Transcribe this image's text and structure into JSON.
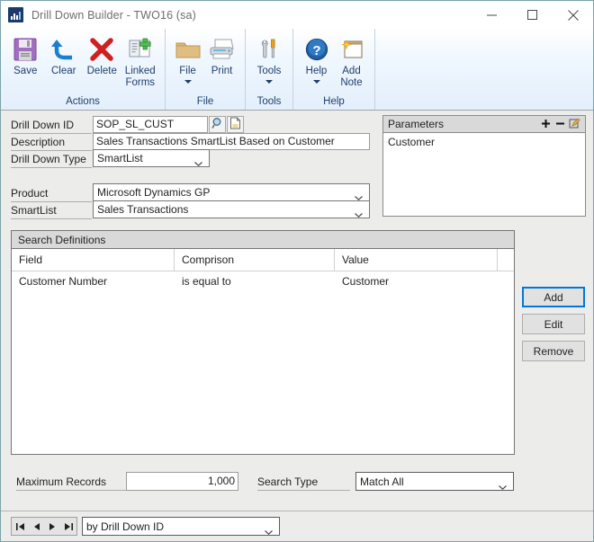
{
  "window": {
    "title": "Drill Down Builder  -  TWO16 (sa)",
    "app_icon": "bar-chart-icon",
    "minimize": "minimize-icon",
    "maximize": "maximize-icon",
    "close": "close-icon"
  },
  "ribbon": {
    "groups": [
      {
        "label": "Actions",
        "items": [
          {
            "label": "Save",
            "icon": "save-floppy-icon",
            "has_caret": false
          },
          {
            "label": "Clear",
            "icon": "undo-arrow-icon",
            "has_caret": false
          },
          {
            "label": "Delete",
            "icon": "red-x-icon",
            "has_caret": false
          },
          {
            "label": "Linked\nForms",
            "label_line1": "Linked",
            "label_line2": "Forms",
            "icon": "linked-forms-icon",
            "has_caret": false
          }
        ]
      },
      {
        "label": "File",
        "items": [
          {
            "label": "File",
            "icon": "folder-icon",
            "has_caret": true
          },
          {
            "label": "Print",
            "icon": "printer-icon",
            "has_caret": false
          }
        ]
      },
      {
        "label": "Tools",
        "items": [
          {
            "label": "Tools",
            "icon": "wrench-screwdriver-icon",
            "has_caret": true
          }
        ]
      },
      {
        "label": "Help",
        "items": [
          {
            "label": "Help",
            "icon": "help-question-icon",
            "has_caret": true
          },
          {
            "label": "Add\nNote",
            "label_line1": "Add",
            "label_line2": "Note",
            "icon": "add-note-icon",
            "has_caret": false
          }
        ]
      }
    ]
  },
  "form": {
    "drill_down_id": {
      "label": "Drill Down ID",
      "value": "SOP_SL_CUST"
    },
    "description": {
      "label": "Description",
      "value": "Sales Transactions SmartList Based on Customer"
    },
    "drill_down_type": {
      "label": "Drill Down Type",
      "value": "SmartList"
    },
    "product": {
      "label": "Product",
      "value": "Microsoft Dynamics GP"
    },
    "smartlist": {
      "label": "SmartList",
      "value": "Sales Transactions"
    },
    "lookup_icon": "magnifier-lookup-icon",
    "note_icon": "note-page-icon"
  },
  "parameters": {
    "title": "Parameters",
    "add_icon": "plus-icon",
    "remove_icon": "minus-icon",
    "edit_icon": "pencil-edit-icon",
    "items": [
      "Customer"
    ]
  },
  "search_definitions": {
    "title": "Search Definitions",
    "columns": [
      "Field",
      "Comprison",
      "Value",
      ""
    ],
    "rows": [
      {
        "field": "Customer Number",
        "comparison": "is equal to",
        "value": "Customer",
        "extra": ""
      }
    ],
    "buttons": {
      "add": "Add",
      "edit": "Edit",
      "remove": "Remove"
    }
  },
  "footer": {
    "maximum_records": {
      "label": "Maximum Records",
      "value": "1,000"
    },
    "search_type": {
      "label": "Search Type",
      "value": "Match All"
    }
  },
  "navbar": {
    "first": "first-record-icon",
    "previous": "previous-record-icon",
    "next": "next-record-icon",
    "last": "last-record-icon",
    "sort_by": "by Drill Down ID"
  },
  "colors": {
    "window_border": "#7aa3a8",
    "ribbon_bottom": "#e3effb",
    "focus_ring": "#0078d7",
    "label_underline": "#adadad"
  }
}
